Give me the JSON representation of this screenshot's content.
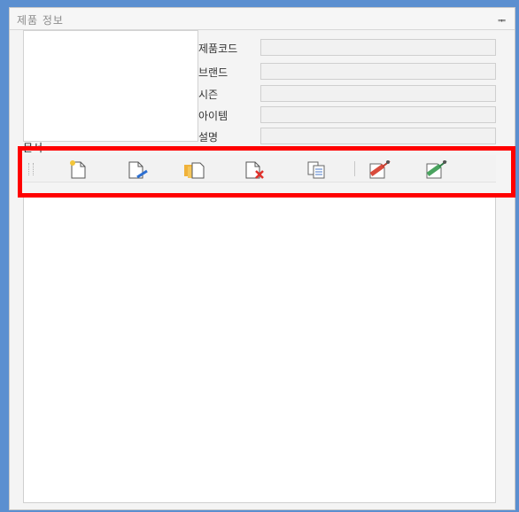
{
  "panel": {
    "title": "제품 정보",
    "pin_glyph": "ᆍ"
  },
  "fields": [
    {
      "label": "제품코드",
      "value": ""
    },
    {
      "label": "브랜드",
      "value": ""
    },
    {
      "label": "시즌",
      "value": ""
    },
    {
      "label": "아이템",
      "value": ""
    },
    {
      "label": "설명",
      "value": ""
    }
  ],
  "documents": {
    "label": "문서"
  },
  "toolbar": {
    "buttons": [
      {
        "icon": "new-document-icon"
      },
      {
        "icon": "edit-document-icon"
      },
      {
        "icon": "copy-documents-icon"
      },
      {
        "icon": "delete-document-icon"
      },
      {
        "icon": "paste-document-icon"
      },
      {
        "icon": "attach-red-icon"
      },
      {
        "icon": "attach-green-icon"
      }
    ]
  },
  "colors": {
    "frame": "#5b8fd0",
    "highlight": "#ff0000"
  }
}
